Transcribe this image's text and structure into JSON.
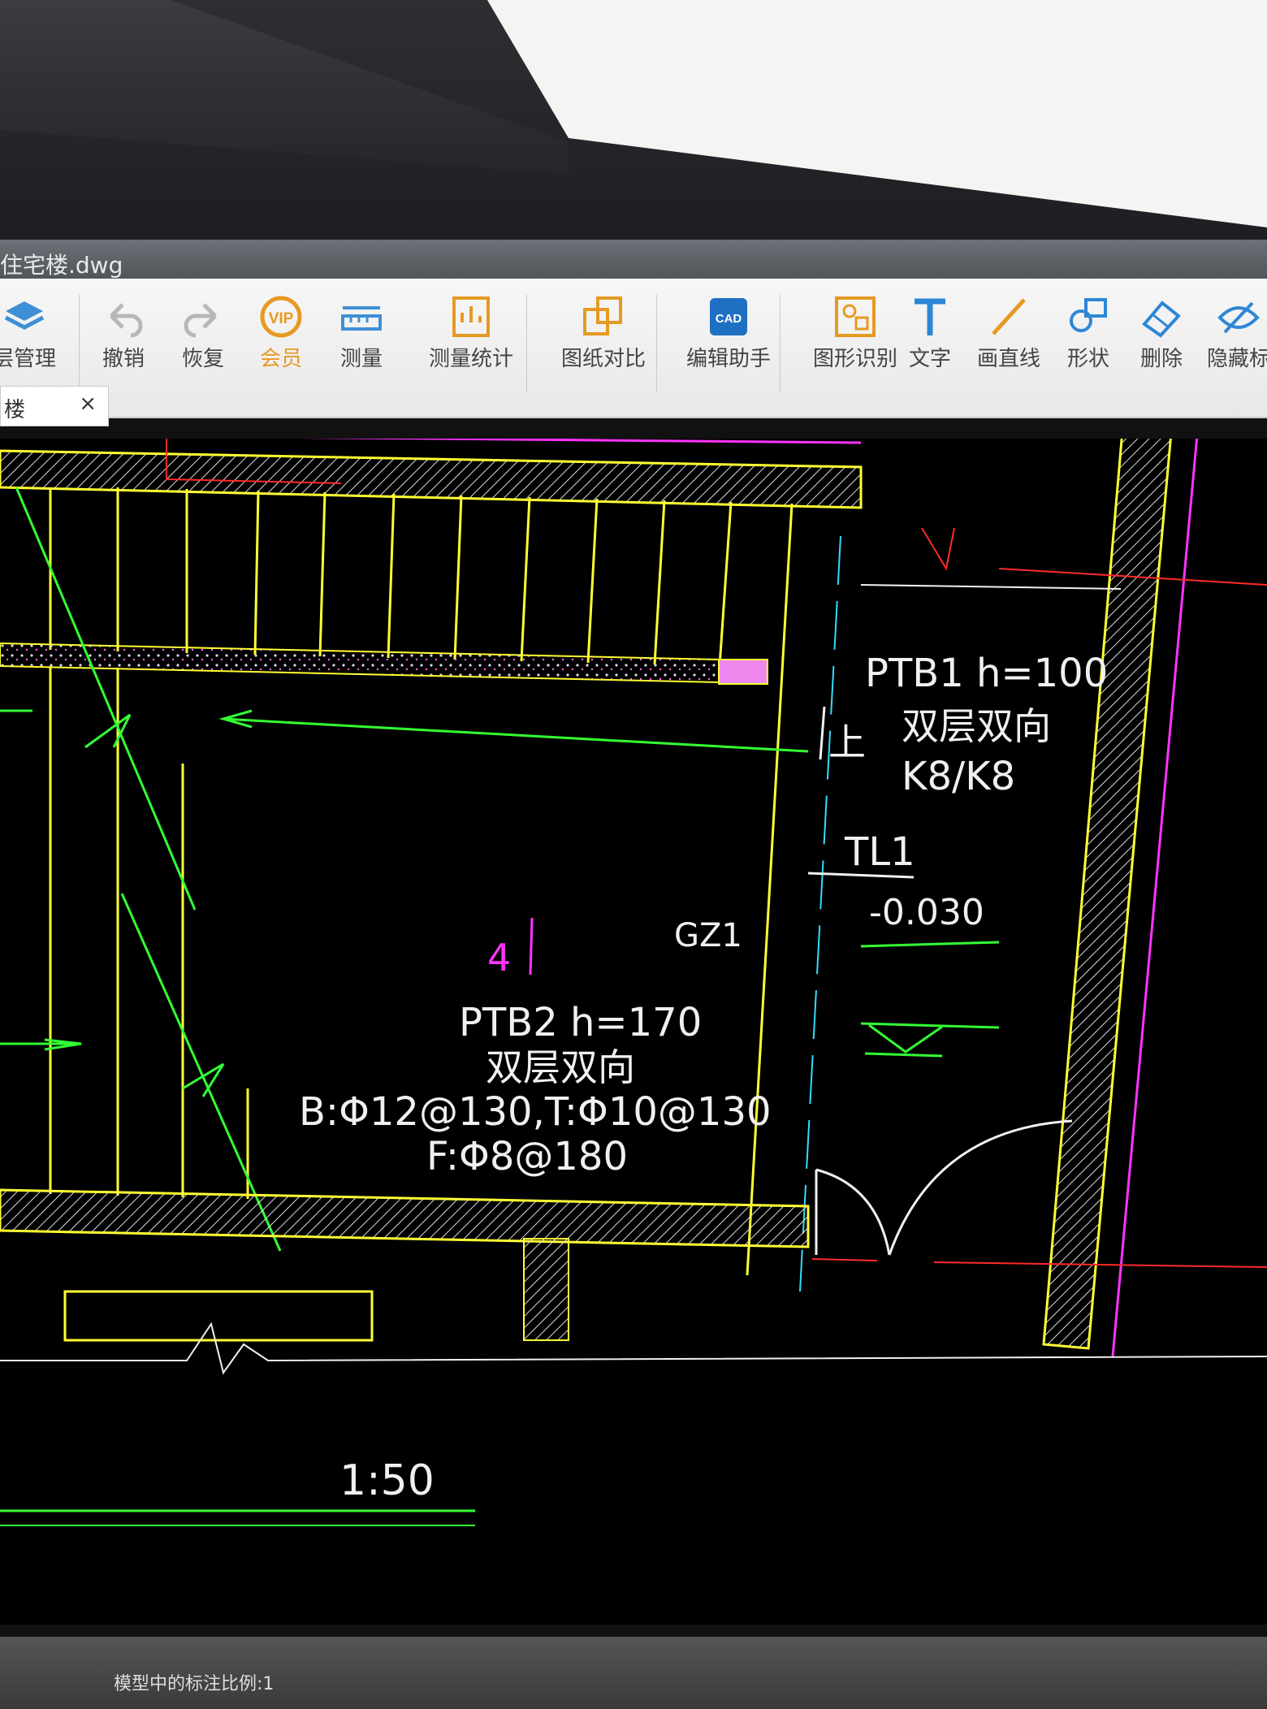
{
  "window": {
    "title": "住宅楼.dwg"
  },
  "toolbar": {
    "items": [
      {
        "label": "层管理",
        "icon": "layers-icon"
      },
      {
        "label": "撤销",
        "icon": "undo-icon"
      },
      {
        "label": "恢复",
        "icon": "redo-icon"
      },
      {
        "label": "会员",
        "icon": "vip-icon"
      },
      {
        "label": "测量",
        "icon": "ruler-icon"
      },
      {
        "label": "测量统计",
        "icon": "measure-stats-icon"
      },
      {
        "label": "图纸对比",
        "icon": "compare-drawings-icon"
      },
      {
        "label": "编辑助手",
        "icon": "cad-edit-assistant-icon"
      },
      {
        "label": "图形识别",
        "icon": "shape-recognition-icon"
      },
      {
        "label": "文字",
        "icon": "text-icon"
      },
      {
        "label": "画直线",
        "icon": "draw-line-icon"
      },
      {
        "label": "形状",
        "icon": "shape-icon"
      },
      {
        "label": "删除",
        "icon": "eraser-icon"
      },
      {
        "label": "隐藏标",
        "icon": "hide-annotation-icon"
      }
    ]
  },
  "tab": {
    "label": "楼",
    "close": "×"
  },
  "drawing": {
    "ptb1": {
      "line1": "PTB1  h=100",
      "line2": "双层双向",
      "line3": "K8/K8"
    },
    "up_label": "上",
    "beam": "TL1",
    "elevation": "-0.030",
    "gz": "GZ1",
    "axis_marker": "4",
    "ptb2": {
      "line1": "PTB2  h=170",
      "line2": "双层双向",
      "line3": "B:Φ12@130,T:Φ10@130",
      "line4": "F:Φ8@180"
    },
    "scale": "1:50"
  },
  "status": {
    "text": "模型中的标注比例:1"
  },
  "colors": {
    "yellow": "#ffff33",
    "green": "#33ff33",
    "magenta": "#ff33ff",
    "red": "#ff2a2a",
    "cyan": "#33ddff",
    "white": "#f0f0f0"
  }
}
